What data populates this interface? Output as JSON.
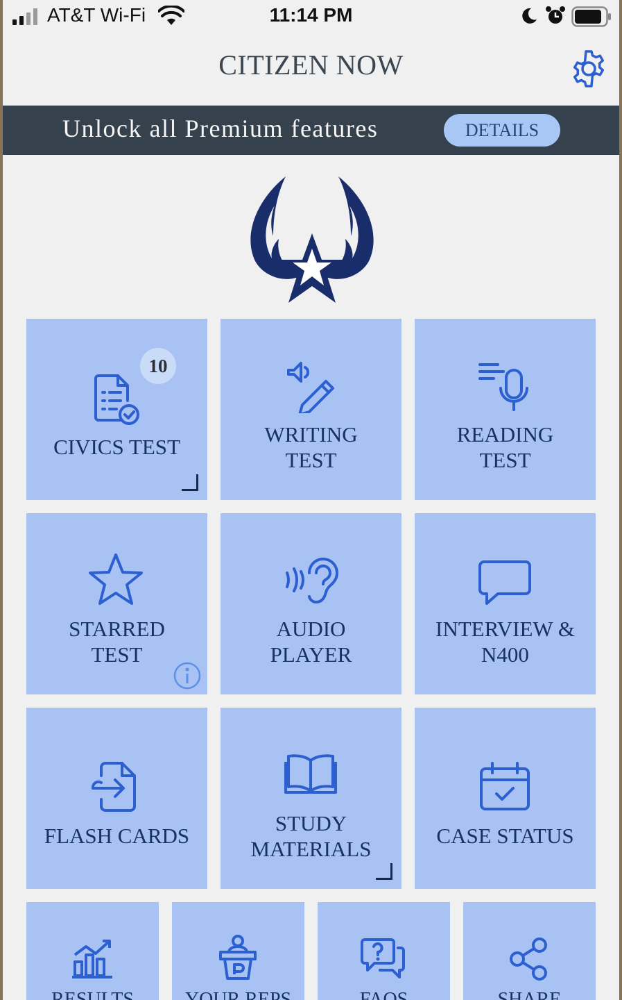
{
  "status_bar": {
    "carrier": "AT&T Wi-Fi",
    "time": "11:14 PM"
  },
  "header": {
    "title": "CITIZEN NOW"
  },
  "banner": {
    "text": "Unlock all Premium features",
    "button": "DETAILS"
  },
  "tiles": [
    {
      "label": "CIVICS TEST",
      "badge": "10",
      "icon": "checklist-icon"
    },
    {
      "label": "WRITING\nTEST",
      "icon": "pencil-speaker-icon"
    },
    {
      "label": "READING\nTEST",
      "icon": "microphone-icon"
    },
    {
      "label": "STARRED\nTEST",
      "icon": "star-icon"
    },
    {
      "label": "AUDIO\nPLAYER",
      "icon": "ear-icon"
    },
    {
      "label": "INTERVIEW &\nN400",
      "icon": "chat-bubble-icon"
    },
    {
      "label": "FLASH CARDS",
      "icon": "flash-card-icon"
    },
    {
      "label": "STUDY\nMATERIALS",
      "icon": "book-icon"
    },
    {
      "label": "CASE STATUS",
      "icon": "calendar-check-icon"
    },
    {
      "label": "RESULTS",
      "icon": "bar-chart-icon"
    },
    {
      "label": "YOUR REPS",
      "icon": "podium-icon"
    },
    {
      "label": "FAQS",
      "icon": "question-bubble-icon"
    },
    {
      "label": "SHARE",
      "icon": "share-icon"
    }
  ],
  "colors": {
    "tile": "#a8c3f3",
    "icon": "#2c5fd0",
    "banner": "#35414c",
    "logo": "#1a2d6b"
  }
}
